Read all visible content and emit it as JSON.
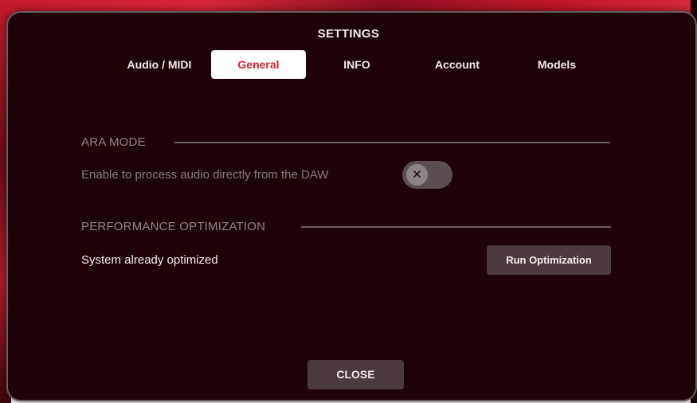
{
  "dialog": {
    "title": "SETTINGS",
    "tabs": [
      {
        "label": "Audio / MIDI",
        "active": false
      },
      {
        "label": "General",
        "active": true
      },
      {
        "label": "INFO",
        "active": false
      },
      {
        "label": "Account",
        "active": false
      },
      {
        "label": "Models",
        "active": false
      }
    ],
    "ara_mode": {
      "heading": "ARA MODE",
      "description": "Enable to process audio directly from the DAW",
      "toggle_enabled": false,
      "toggle_icon": "close-icon",
      "toggle_glyph": "✕"
    },
    "performance": {
      "heading": "PERFORMANCE OPTIMIZATION",
      "status": "System already optimized",
      "button_label": "Run Optimization"
    },
    "close_label": "CLOSE"
  },
  "colors": {
    "dialog_bg": "#1e0408",
    "accent_red": "#d71f2f",
    "button_bg": "#4a3a3d",
    "muted_text": "#857b7d"
  }
}
